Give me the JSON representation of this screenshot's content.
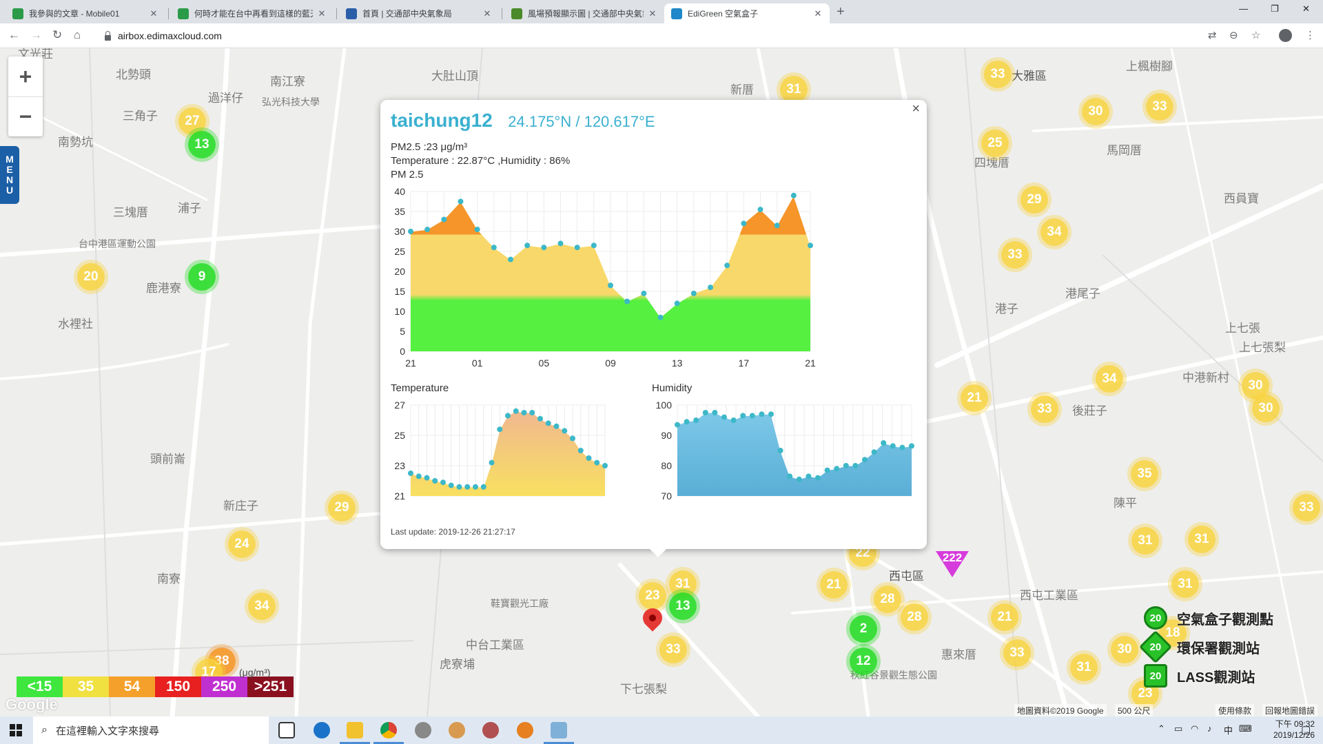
{
  "browser": {
    "tabs": [
      {
        "label": "我參與的文章 - Mobile01",
        "color": "#2b9b4a"
      },
      {
        "label": "何時才能在台中再看到這樣的藍天",
        "color": "#2b9b4a"
      },
      {
        "label": "首頁 | 交通部中央氣象局",
        "color": "#2a5ea8"
      },
      {
        "label": "風場預報顯示圖 | 交通部中央氣象",
        "color": "#4a8a2a"
      },
      {
        "label": "EdiGreen 空氣盒子",
        "color": "#1e88c9"
      }
    ],
    "active_tab": 4,
    "url": "airbox.edimaxcloud.com"
  },
  "map": {
    "menu_label": "MENU",
    "zoom_in": "+",
    "zoom_out": "−",
    "places": [
      {
        "t": "文光莊"
      },
      {
        "t": "北勢頭"
      },
      {
        "t": "南江寮"
      },
      {
        "t": "大肚山頂"
      },
      {
        "t": "新厝"
      },
      {
        "t": "大雅區"
      },
      {
        "t": "上楓樹腳"
      },
      {
        "t": "過洋仔"
      },
      {
        "t": "弘光科技大學"
      },
      {
        "t": "三角子"
      },
      {
        "t": "南勢坑"
      },
      {
        "t": "三塊厝"
      },
      {
        "t": "浦子"
      },
      {
        "t": "台中港區運動公園"
      },
      {
        "t": "鹿港寮"
      },
      {
        "t": "水裡社"
      },
      {
        "t": "頭前崙"
      },
      {
        "t": "新庄子"
      },
      {
        "t": "南寮"
      },
      {
        "t": "四塊厝"
      },
      {
        "t": "馬岡厝"
      },
      {
        "t": "西員寶"
      },
      {
        "t": "港子"
      },
      {
        "t": "港尾子"
      },
      {
        "t": "上七張"
      },
      {
        "t": "上七張梨"
      },
      {
        "t": "中港新村"
      },
      {
        "t": "後莊子"
      },
      {
        "t": "西屯區"
      },
      {
        "t": "西屯工業區"
      },
      {
        "t": "惠來厝"
      },
      {
        "t": "中台工業區"
      },
      {
        "t": "虎寮埔"
      },
      {
        "t": "下七張梨"
      },
      {
        "t": "鞋寶觀光工廠"
      },
      {
        "t": "秋紅谷景觀生態公園"
      },
      {
        "t": "陳平"
      }
    ],
    "clusters": [
      {
        "v": "27",
        "c": "y"
      },
      {
        "v": "13",
        "c": "g"
      },
      {
        "v": "31",
        "c": "y"
      },
      {
        "v": "33",
        "c": "y"
      },
      {
        "v": "30",
        "c": "y"
      },
      {
        "v": "33",
        "c": "y"
      },
      {
        "v": "25",
        "c": "y"
      },
      {
        "v": "29",
        "c": "y"
      },
      {
        "v": "34",
        "c": "y"
      },
      {
        "v": "33",
        "c": "y"
      },
      {
        "v": "20",
        "c": "y"
      },
      {
        "v": "9",
        "c": "g"
      },
      {
        "v": "34",
        "c": "y"
      },
      {
        "v": "21",
        "c": "y"
      },
      {
        "v": "33",
        "c": "y"
      },
      {
        "v": "30",
        "c": "y"
      },
      {
        "v": "30",
        "c": "y"
      },
      {
        "v": "35",
        "c": "y"
      },
      {
        "v": "29",
        "c": "y"
      },
      {
        "v": "24",
        "c": "y"
      },
      {
        "v": "33",
        "c": "y"
      },
      {
        "v": "31",
        "c": "y"
      },
      {
        "v": "31",
        "c": "y"
      },
      {
        "v": "31",
        "c": "y"
      },
      {
        "v": "34",
        "c": "y"
      },
      {
        "v": "31",
        "c": "y"
      },
      {
        "v": "13",
        "c": "g"
      },
      {
        "v": "21",
        "c": "y"
      },
      {
        "v": "28",
        "c": "y"
      },
      {
        "v": "28",
        "c": "y"
      },
      {
        "v": "2",
        "c": "g"
      },
      {
        "v": "12",
        "c": "g"
      },
      {
        "v": "21",
        "c": "y"
      },
      {
        "v": "33",
        "c": "y"
      },
      {
        "v": "33",
        "c": "y"
      },
      {
        "v": "31",
        "c": "y"
      },
      {
        "v": "30",
        "c": "y"
      },
      {
        "v": "18",
        "c": "y"
      },
      {
        "v": "23",
        "c": "y"
      },
      {
        "v": "38",
        "c": "o"
      },
      {
        "v": "17",
        "c": "y"
      },
      {
        "v": "23",
        "c": "y"
      },
      {
        "v": "22",
        "c": "y"
      }
    ],
    "lass_marker": "222",
    "legend": [
      {
        "label": "<15",
        "color": "#3ee63e"
      },
      {
        "label": "35",
        "color": "#f0e040"
      },
      {
        "label": "54",
        "color": "#f5a02a"
      },
      {
        "label": "150",
        "color": "#e82020"
      },
      {
        "label": "250",
        "color": "#c030d0"
      },
      {
        "label": ">251",
        "color": "#8a1020"
      }
    ],
    "legend_unit": "(μg/m³)",
    "google": "Google",
    "station_types": [
      {
        "label": "空氣盒子觀測點",
        "badge": "20"
      },
      {
        "label": "環保署觀測站",
        "badge": "20"
      },
      {
        "label": "LASS觀測站",
        "badge": "20"
      }
    ],
    "attribution": "地圖資料©2019 Google",
    "scale": "500 公尺",
    "terms": "使用條款",
    "report": "回報地圖錯誤"
  },
  "popup": {
    "station": "taichung12",
    "coords": "24.175°N / 120.617°E",
    "pm25_line": "PM2.5 :23 μg/m³",
    "temp_hum_line": "Temperature : 22.87°C ,Humidity : 86%",
    "pm_title": "PM 2.5",
    "temp_title": "Temperature",
    "hum_title": "Humidity",
    "last_update": "Last update: 2019-12-26 21:27:17",
    "close": "×"
  },
  "chart_data": [
    {
      "type": "area",
      "title": "PM 2.5",
      "ylim": [
        0,
        40
      ],
      "yticks": [
        0,
        5,
        10,
        15,
        20,
        25,
        30,
        35,
        40
      ],
      "xticks": [
        "21",
        "01",
        "05",
        "09",
        "13",
        "17",
        "21"
      ],
      "values": [
        30,
        30.5,
        33,
        37.5,
        30.5,
        26,
        23,
        26.5,
        26,
        27,
        26,
        26.5,
        16.5,
        12.5,
        14.5,
        8.5,
        12,
        14.5,
        16,
        21.5,
        32,
        35.5,
        31.5,
        39,
        26.5
      ],
      "colors": {
        "good": "#55f040",
        "moderate": "#f8d86a",
        "high": "#f5952a",
        "points": "#3cb8c8"
      },
      "grid": true
    },
    {
      "type": "area",
      "title": "Temperature",
      "ylim": [
        21,
        27
      ],
      "yticks": [
        21,
        23,
        25,
        27
      ],
      "values": [
        22.5,
        22.3,
        22.2,
        22.0,
        21.9,
        21.7,
        21.6,
        21.6,
        21.6,
        21.6,
        23.2,
        25.4,
        26.3,
        26.6,
        26.5,
        26.5,
        26.1,
        25.8,
        25.6,
        25.3,
        24.8,
        24.0,
        23.5,
        23.2,
        23.0
      ],
      "colors": {
        "top": "#f0b890",
        "bottom": "#f8e060",
        "points": "#3cb8c8"
      },
      "grid": true
    },
    {
      "type": "area",
      "title": "Humidity",
      "ylim": [
        70,
        100
      ],
      "yticks": [
        70,
        80,
        90,
        100
      ],
      "values": [
        93.5,
        94.5,
        95,
        97.5,
        97.5,
        96,
        95,
        96.5,
        96.5,
        97,
        97,
        85,
        76.5,
        75.5,
        76.5,
        76,
        78.5,
        79,
        80,
        80,
        82,
        84.5,
        87.5,
        86.5,
        86,
        86.5
      ],
      "colors": {
        "top": "#7cc8e8",
        "bottom": "#5aaed6",
        "points": "#3cb8c8"
      },
      "grid": true
    }
  ],
  "taskbar": {
    "search_placeholder": "在這裡輸入文字來搜尋",
    "time": "下午 09:32",
    "date": "2019/12/26",
    "ime": "中"
  }
}
